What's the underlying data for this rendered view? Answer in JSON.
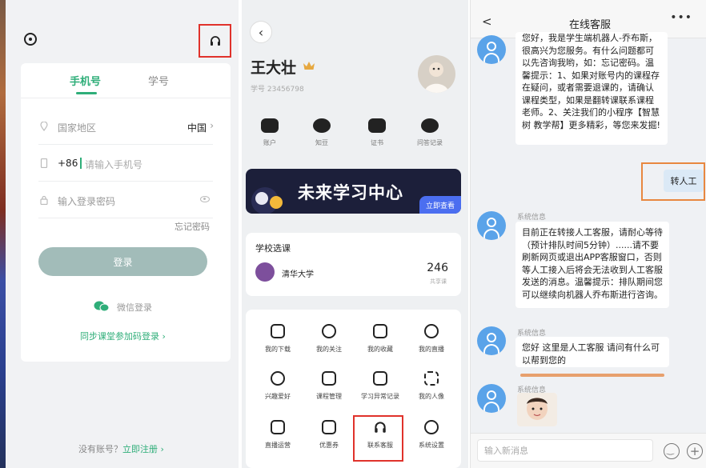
{
  "login": {
    "tabs": [
      "手机号",
      "学号"
    ],
    "country_label": "国家地区",
    "country_value": "中国",
    "country_code": "+86",
    "phone_placeholder": "请输入手机号",
    "password_placeholder": "输入登录密码",
    "forgot": "忘记密码",
    "login_button": "登录",
    "wechat_login": "微信登录",
    "sync_link": "同步课堂参加码登录 ›",
    "no_account": "没有账号？",
    "register": "立即注册 ›"
  },
  "profile": {
    "name": "王大壮",
    "student_no": "学号 23456798",
    "quick": [
      "账户",
      "知豆",
      "证书",
      "问答记录"
    ],
    "banner_title": "未来学习中心",
    "banner_button": "立即查看",
    "school_section_title": "学校选课",
    "school_name": "清华大学",
    "course_count": "246",
    "course_count_sub": "共享课",
    "grid": [
      "我的下载",
      "我的关注",
      "我的收藏",
      "我的直播",
      "兴趣爱好",
      "课程管理",
      "学习异常记录",
      "我的人像",
      "直播运营",
      "优惠券",
      "联系客服",
      "系统设置"
    ]
  },
  "chat": {
    "title": "在线客服",
    "msg1": "您好，我是学生端机器人-乔布斯，很高兴为您服务。有什么问题都可以先咨询我哟，如：忘记密码。温馨提示：1、如果对账号内的课程存在疑问，或者需要退课的，请确认课程类型，如果是翻转课联系课程老师。2、关注我们的小程序【智慧树 教学帮】更多精彩，等您来发掘!",
    "user_msg": "转人工",
    "sys_label": "系统信息",
    "msg2": "目前正在转接人工客服，请耐心等待（预计排队时间5分钟）......请不要刷新网页或退出APP客服窗口，否则等人工接入后将会无法收到人工客服发送的消息。温馨提示：排队期间您可以继续向机器人乔布斯进行咨询。",
    "msg3": "您好 这里是人工客服 请问有什么可以帮到您的",
    "input_placeholder": "输入新消息"
  },
  "colors": {
    "accent_green": "#2fae79",
    "highlight_red": "#e0322b",
    "highlight_orange": "#e8873f",
    "bot_blue": "#5aa3e9"
  }
}
